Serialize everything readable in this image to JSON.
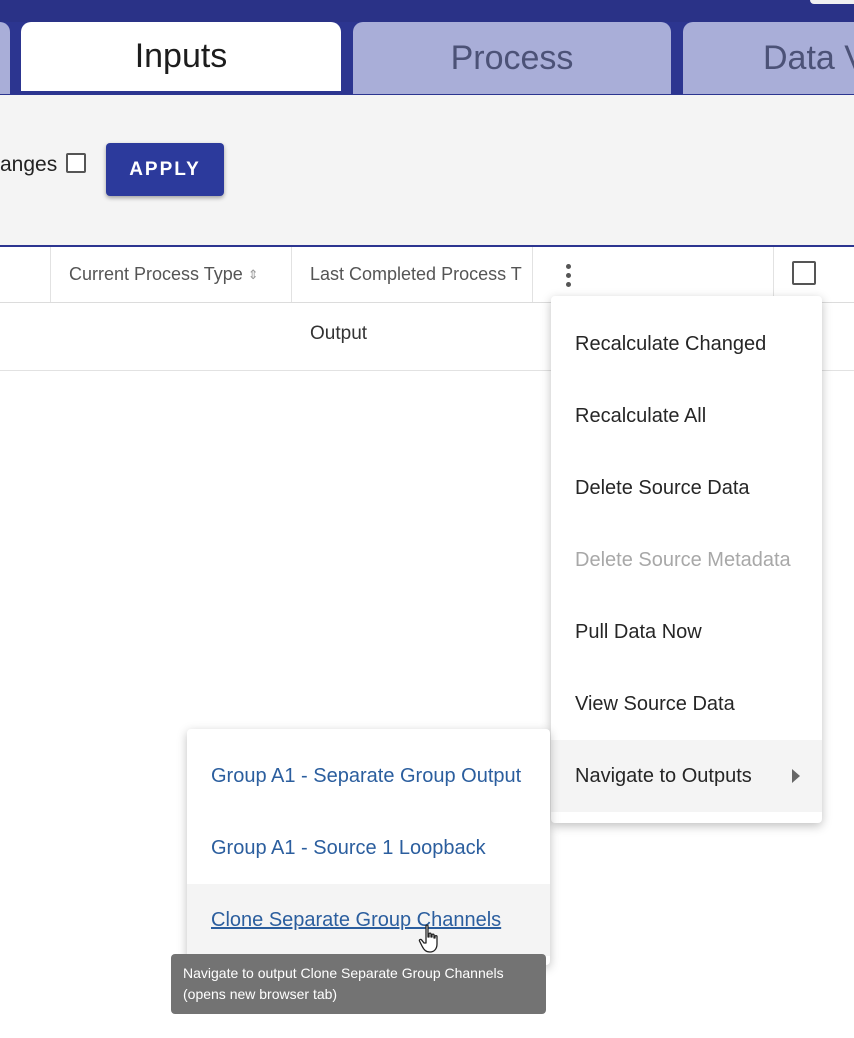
{
  "tabs": {
    "inputs": "Inputs",
    "process": "Process",
    "data": "Data V"
  },
  "toolbar": {
    "changes_label": "anges",
    "apply_label": "APPLY"
  },
  "table": {
    "columns": [
      "Current Process Type",
      "Last Completed Process T"
    ],
    "rows": [
      {
        "last_completed": "Output"
      }
    ]
  },
  "context_menu": {
    "items": [
      {
        "label": "Recalculate Changed",
        "disabled": false
      },
      {
        "label": "Recalculate All",
        "disabled": false
      },
      {
        "label": "Delete Source Data",
        "disabled": false
      },
      {
        "label": "Delete Source Metadata",
        "disabled": true
      },
      {
        "label": "Pull Data Now",
        "disabled": false
      },
      {
        "label": "View Source Data",
        "disabled": false
      },
      {
        "label": "Navigate to Outputs",
        "disabled": false,
        "has_submenu": true
      }
    ]
  },
  "outputs_submenu": {
    "items": [
      "Group A1 - Separate Group Output",
      "Group A1 - Source 1 Loopback",
      "Clone Separate Group Channels"
    ]
  },
  "tooltip": {
    "line1": "Navigate to output Clone Separate Group Channels",
    "line2": "(opens new browser tab)"
  },
  "colors": {
    "header_bg": "#2c3590",
    "apply_button": "#2c3a9c",
    "link": "#2b5e9e",
    "tooltip_bg": "#737373"
  },
  "icons": {
    "sort": "sort-icon",
    "kebab": "kebab-menu-icon",
    "submenu_arrow": "caret-right-icon",
    "cursor": "hand-pointer-icon"
  }
}
